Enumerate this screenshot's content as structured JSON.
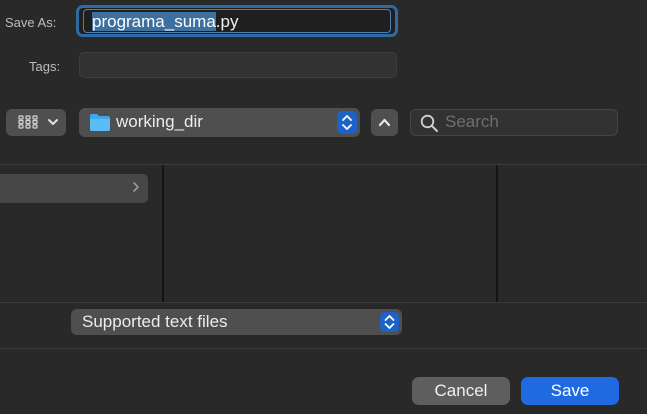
{
  "save_as": {
    "label": "Save As:",
    "filename_selected": "programa_suma",
    "filename_extension": ".py"
  },
  "tags": {
    "label": "Tags:",
    "value": ""
  },
  "toolbar": {
    "view_mode_icon": "grid-icon",
    "location": {
      "icon": "folder-icon",
      "name": "working_dir"
    },
    "up_icon": "chevron-up-icon",
    "search": {
      "icon": "search-icon",
      "placeholder": "Search"
    }
  },
  "browser": {
    "columns": [
      {
        "rows": [
          {
            "label": "",
            "selected": true,
            "has_children": true
          }
        ]
      },
      {
        "rows": []
      },
      {
        "rows": []
      }
    ]
  },
  "file_format": {
    "selected": "Supported text files"
  },
  "buttons": {
    "cancel": "Cancel",
    "save": "Save"
  },
  "colors": {
    "accent": "#1f6ae0",
    "selection": "#3d6f9f",
    "background": "#2a2929"
  }
}
